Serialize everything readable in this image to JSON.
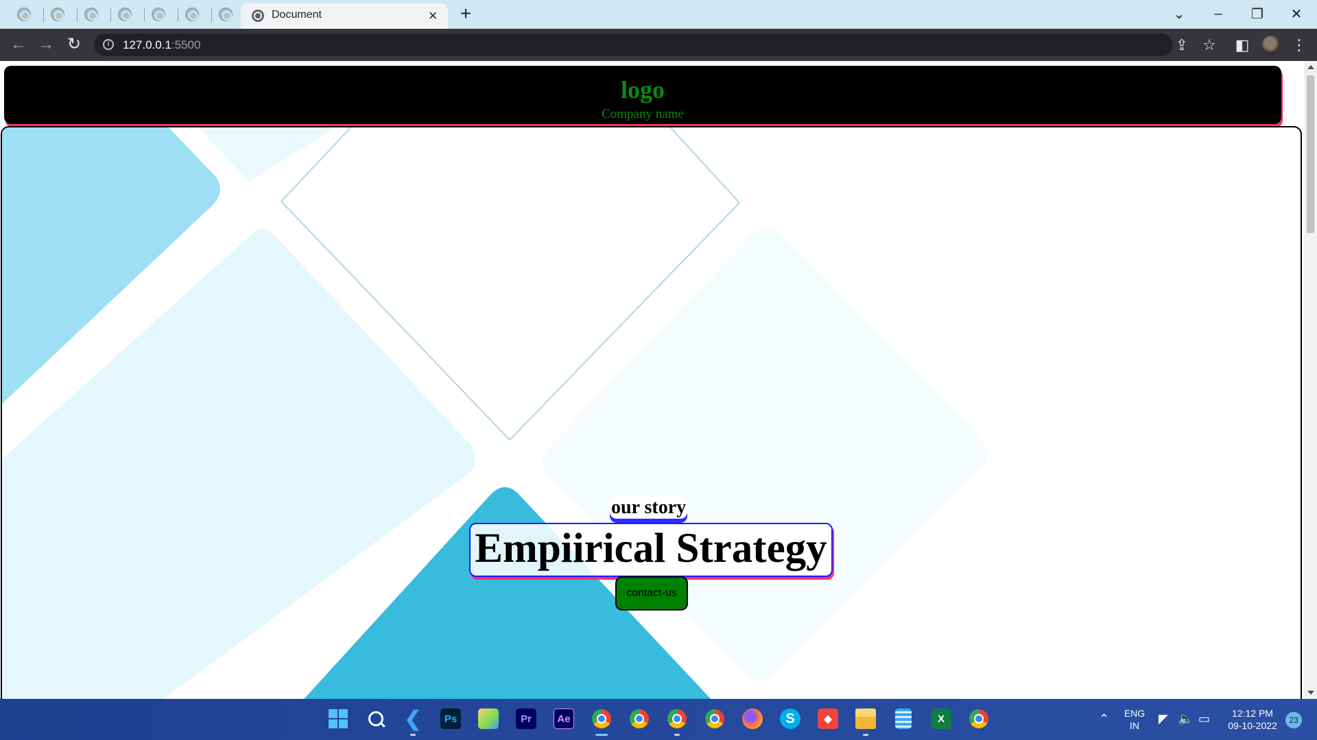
{
  "browser": {
    "active_tab": {
      "title": "Document",
      "close": "×"
    },
    "new_tab": "+",
    "window_controls": {
      "tab_search": "⌄",
      "minimize": "–",
      "restore": "❐",
      "close": "✕"
    },
    "nav": {
      "back": "←",
      "forward": "→",
      "reload": "↻"
    },
    "address": {
      "host": "127.0.0.1",
      "port": ":5500"
    },
    "toolbar_icons": {
      "share": "⇪",
      "bookmark": "☆",
      "sidepanel": "◧",
      "menu": "⋮"
    }
  },
  "page": {
    "header": {
      "logo": "logo",
      "company": "Company name"
    },
    "hero": {
      "eyebrow": "our story",
      "title": "Empiirical Strategy",
      "cta": "contact-us"
    }
  },
  "taskbar": {
    "apps": [
      {
        "name": "windows-start",
        "label": ""
      },
      {
        "name": "search",
        "label": ""
      },
      {
        "name": "vscode",
        "label": ""
      },
      {
        "name": "photoshop",
        "label": "Ps"
      },
      {
        "name": "paint",
        "label": ""
      },
      {
        "name": "premiere",
        "label": "Pr"
      },
      {
        "name": "after-effects",
        "label": "Ae"
      },
      {
        "name": "chrome-1",
        "label": ""
      },
      {
        "name": "chrome-2",
        "label": ""
      },
      {
        "name": "chrome-3",
        "label": ""
      },
      {
        "name": "chrome-4",
        "label": ""
      },
      {
        "name": "firefox",
        "label": ""
      },
      {
        "name": "skype",
        "label": "S"
      },
      {
        "name": "anydesk",
        "label": ""
      },
      {
        "name": "file-explorer",
        "label": ""
      },
      {
        "name": "notepad",
        "label": ""
      },
      {
        "name": "excel",
        "label": ""
      },
      {
        "name": "chrome-5",
        "label": ""
      }
    ],
    "tray": {
      "lang_top": "ENG",
      "lang_bottom": "IN",
      "time": "12:12 PM",
      "date": "09-10-2022",
      "notifications": "23"
    }
  },
  "colors": {
    "header_bg": "#000000",
    "logo_green": "#0a8a0a",
    "accent_pink": "#ff2a6d",
    "accent_blue": "#1a1aff",
    "cta_green": "#008000"
  }
}
